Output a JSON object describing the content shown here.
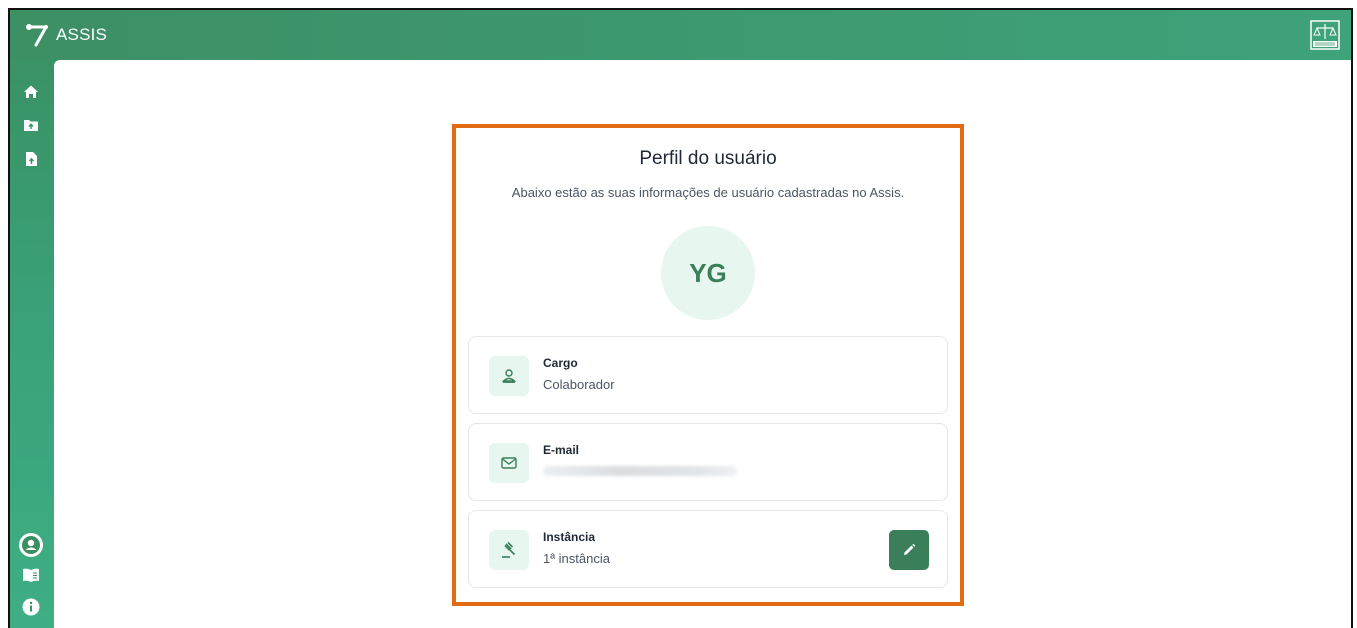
{
  "app": {
    "name": "ASSIS"
  },
  "profile": {
    "title": "Perfil do usuário",
    "subtitle": "Abaixo estão as suas informações de usuário cadastradas no Assis.",
    "initials": "YG",
    "fields": [
      {
        "label": "Cargo",
        "value": "Colaborador",
        "icon": "person-icon"
      },
      {
        "label": "E-mail",
        "value": "",
        "icon": "mail-icon",
        "redacted": true
      },
      {
        "label": "Instância",
        "value": "1ª instância",
        "icon": "gavel-icon",
        "editable": true
      }
    ]
  },
  "sidebar": {
    "top": [
      "home-icon",
      "folder-upload-icon",
      "file-upload-icon"
    ],
    "bottom": [
      "user-circle-icon",
      "book-icon",
      "info-icon"
    ]
  },
  "colors": {
    "primary": "#3a8f62",
    "primary_dark": "#3a7f59",
    "avatar_bg": "#e7f6ef",
    "highlight": "#e36b12"
  }
}
